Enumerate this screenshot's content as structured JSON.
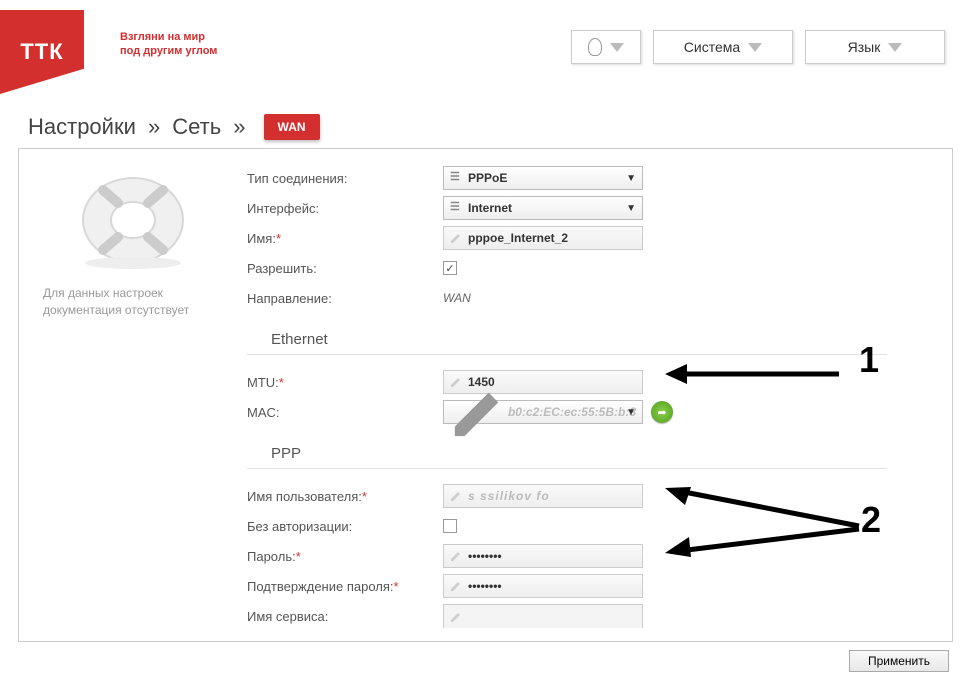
{
  "header": {
    "logo_text": "ТТК",
    "tagline_l1": "Взгляни на мир",
    "tagline_l2": "под другим углом",
    "system_label": "Система",
    "language_label": "Язык"
  },
  "crumbs": {
    "settings": "Настройки",
    "network": "Сеть",
    "active_tab": "WAN"
  },
  "help": {
    "line1": "Для данных настроек",
    "line2": "документация отсутствует"
  },
  "form": {
    "conn_type_label": "Тип соединения:",
    "conn_type_value": "PPPoE",
    "interface_label": "Интерфейс:",
    "interface_value": "Internet",
    "name_label": "Имя:",
    "name_value": "pppoe_Internet_2",
    "allow_label": "Разрешить:",
    "allow_checked": true,
    "direction_label": "Направление:",
    "direction_value": "WAN"
  },
  "ethernet": {
    "title": "Ethernet",
    "mtu_label": "MTU:",
    "mtu_value": "1450",
    "mac_label": "MAC:",
    "mac_value": "b0:c2:EC:ec:55:5B:b:8"
  },
  "ppp": {
    "title": "PPP",
    "username_label": "Имя пользователя:",
    "username_value": "s ssilikov fo",
    "noauth_label": "Без авторизации:",
    "noauth_checked": false,
    "password_label": "Пароль:",
    "password_value": "••••••••",
    "password_confirm_label": "Подтверждение пароля:",
    "password_confirm_value": "••••••••",
    "service_label": "Имя сервиса:"
  },
  "annotations": {
    "n1": "1",
    "n2": "2"
  },
  "footer": {
    "apply": "Применить"
  }
}
